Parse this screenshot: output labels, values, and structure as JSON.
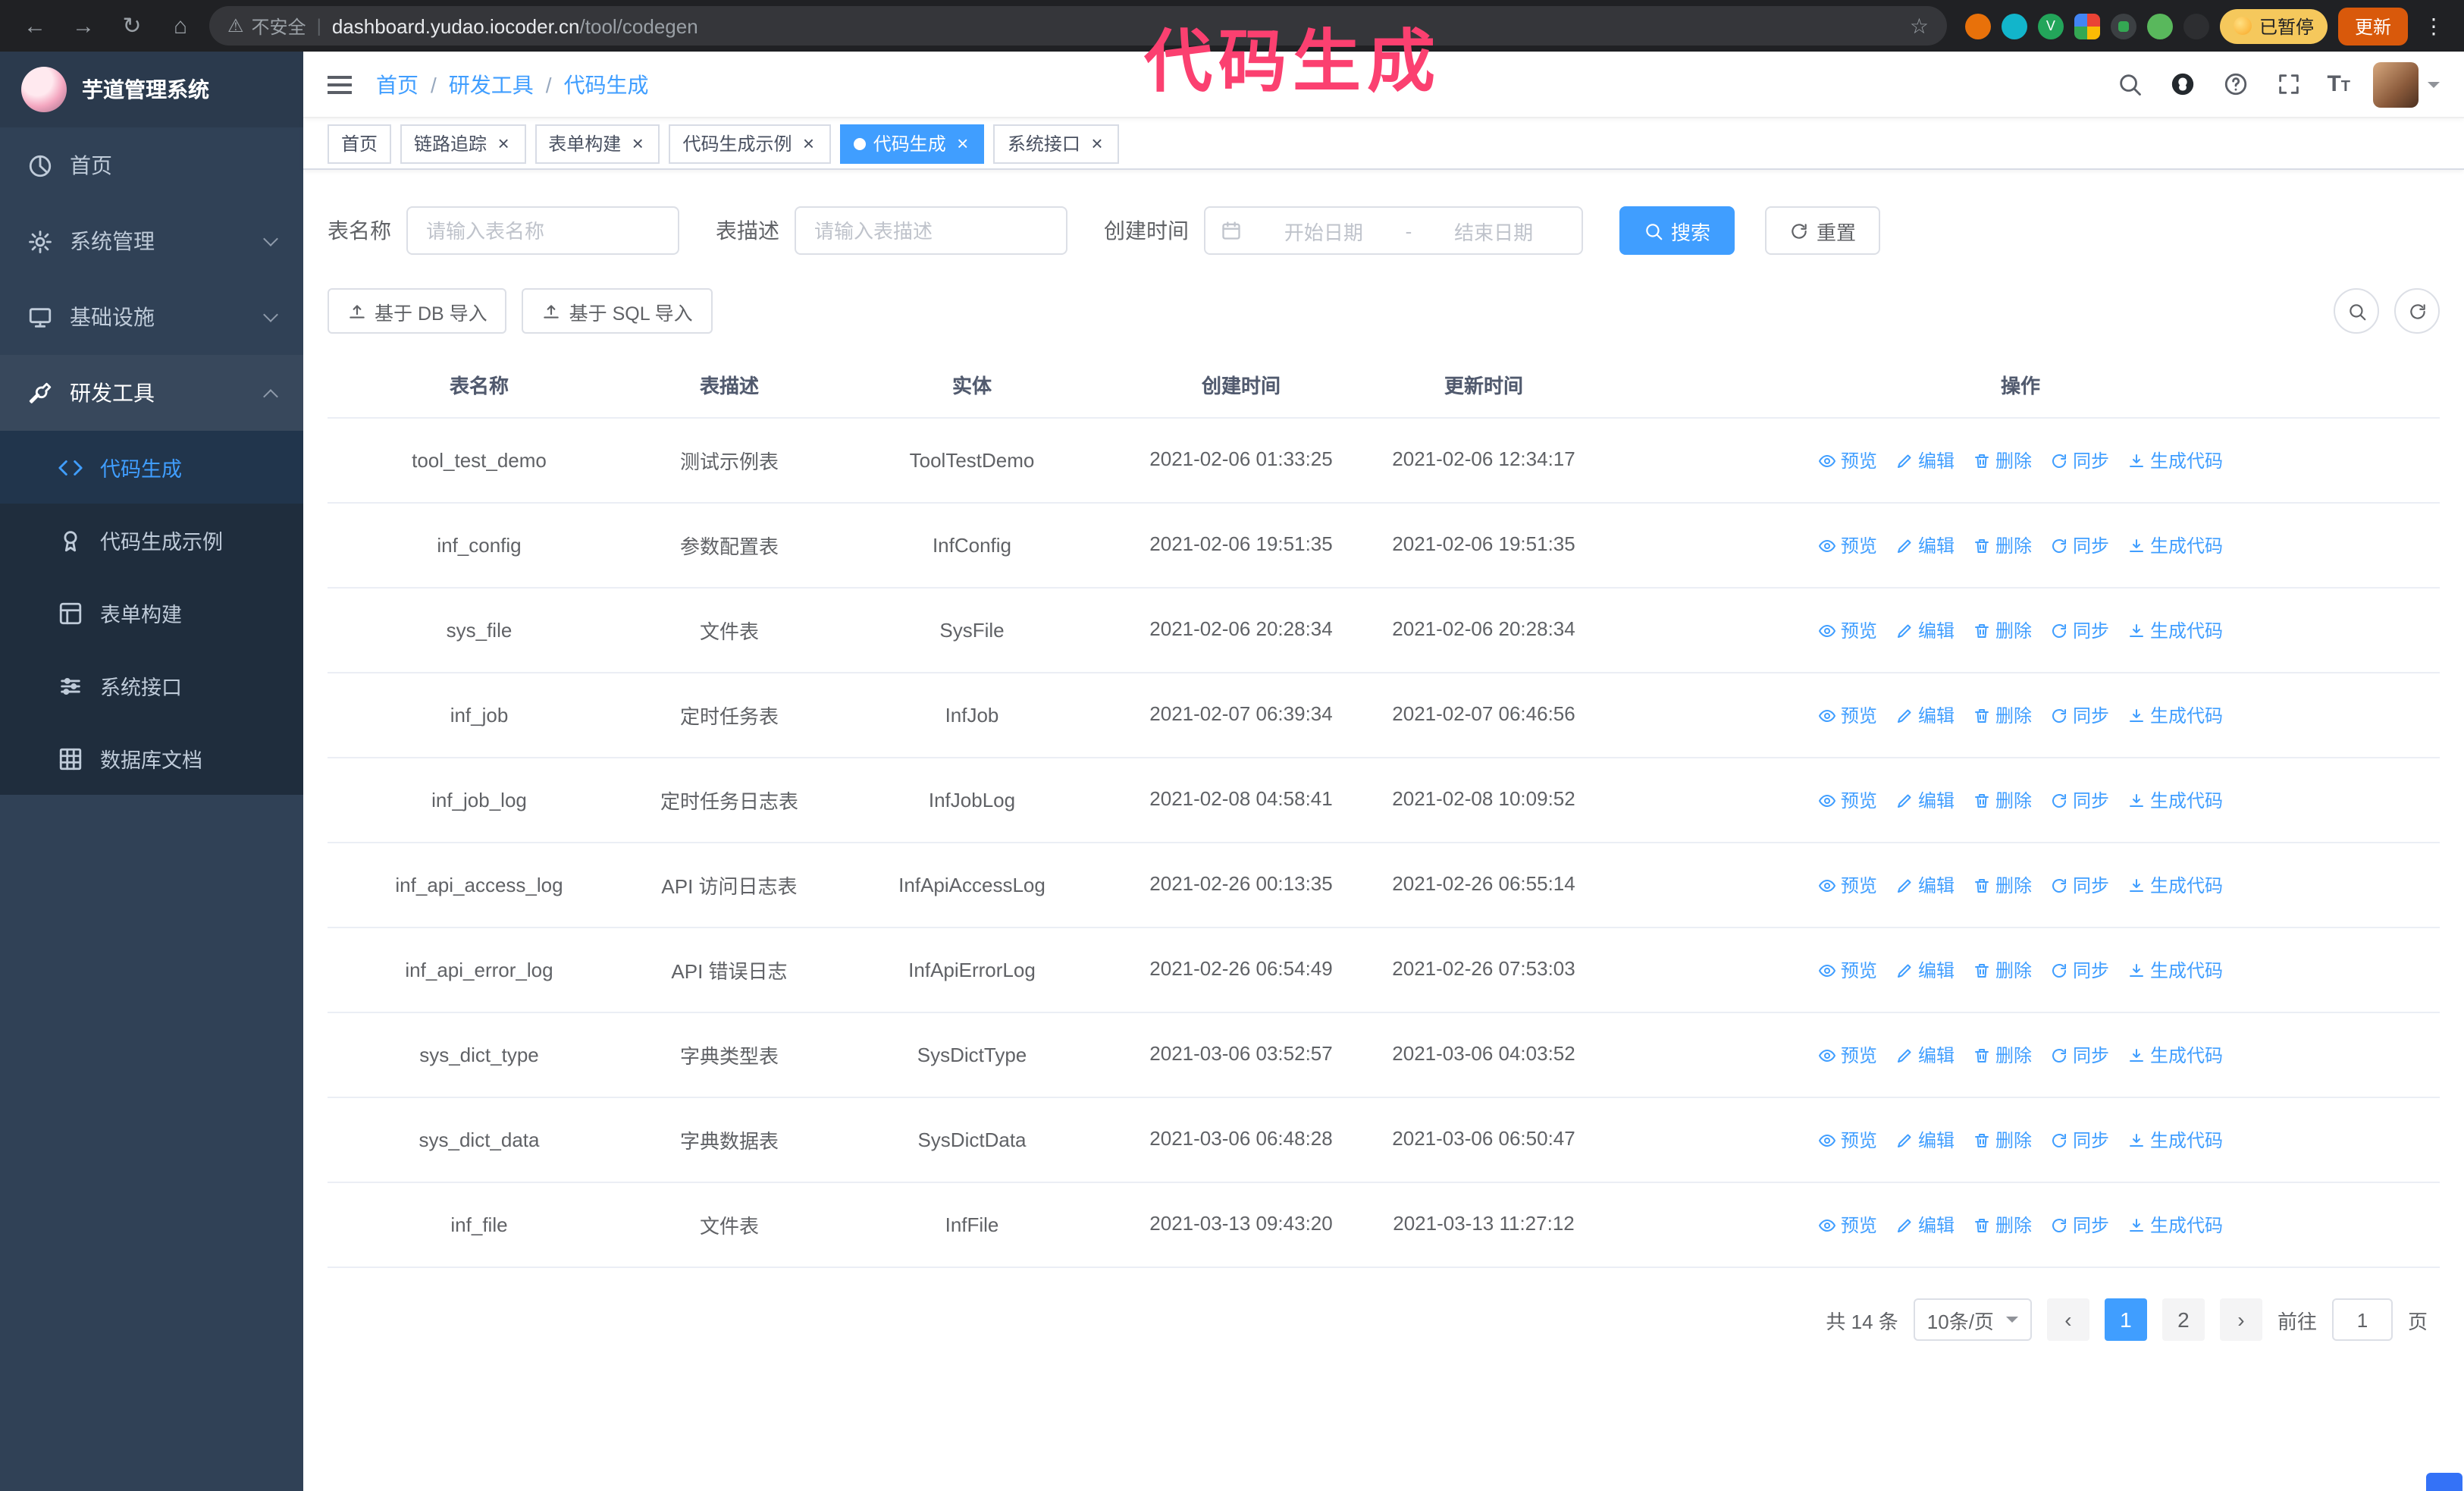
{
  "theme": {
    "accent": "#409eff",
    "sidebar_bg": "#304156",
    "submenu_bg": "#1f2d3d",
    "annotation_color": "#fb4070",
    "tag_active_bg": "#409eff"
  },
  "icons": {
    "back": "←",
    "forward": "→",
    "reload": "↻",
    "home": "⌂",
    "warning": "⚠",
    "divider": "|",
    "star": "☆",
    "kebab": "⋮",
    "prev": "‹",
    "next": "›",
    "v_badge": "V"
  },
  "browser": {
    "security_warning": "不安全",
    "url_host": "dashboard.yudao.iocoder.cn",
    "url_path": "/tool/codegen",
    "paused_badge": "已暂停",
    "update_button": "更新"
  },
  "annotation": {
    "text": "代码生成"
  },
  "sidebar": {
    "logo_title": "芋道管理系统",
    "items": [
      {
        "label": "首页"
      },
      {
        "label": "系统管理"
      },
      {
        "label": "基础设施"
      },
      {
        "label": "研发工具"
      }
    ],
    "submenu": [
      {
        "label": "代码生成"
      },
      {
        "label": "代码生成示例"
      },
      {
        "label": "表单构建"
      },
      {
        "label": "系统接口"
      },
      {
        "label": "数据库文档"
      }
    ]
  },
  "header": {
    "breadcrumb": [
      "首页",
      "研发工具",
      "代码生成"
    ],
    "separator": "/"
  },
  "tabs": [
    {
      "label": "首页",
      "closable": false,
      "active": false
    },
    {
      "label": "链路追踪",
      "closable": true,
      "active": false
    },
    {
      "label": "表单构建",
      "closable": true,
      "active": false
    },
    {
      "label": "代码生成示例",
      "closable": true,
      "active": false
    },
    {
      "label": "代码生成",
      "closable": true,
      "active": true
    },
    {
      "label": "系统接口",
      "closable": true,
      "active": false
    }
  ],
  "filters": {
    "table_name_label": "表名称",
    "table_name_placeholder": "请输入表名称",
    "table_desc_label": "表描述",
    "table_desc_placeholder": "请输入表描述",
    "create_time_label": "创建时间",
    "date_start_placeholder": "开始日期",
    "date_separator": "-",
    "date_end_placeholder": "结束日期",
    "search_button": "搜索",
    "reset_button": "重置"
  },
  "toolbar": {
    "import_db_button": "基于 DB 导入",
    "import_sql_button": "基于 SQL 导入"
  },
  "table": {
    "columns": [
      "表名称",
      "表描述",
      "实体",
      "创建时间",
      "更新时间",
      "操作"
    ],
    "op_labels": [
      "预览",
      "编辑",
      "删除",
      "同步",
      "生成代码"
    ],
    "rows": [
      {
        "name": "tool_test_demo",
        "desc": "测试示例表",
        "entity": "ToolTestDemo",
        "create_time": "2021-02-06 01:33:25",
        "update_time": "2021-02-06 12:34:17"
      },
      {
        "name": "inf_config",
        "desc": "参数配置表",
        "entity": "InfConfig",
        "create_time": "2021-02-06 19:51:35",
        "update_time": "2021-02-06 19:51:35"
      },
      {
        "name": "sys_file",
        "desc": "文件表",
        "entity": "SysFile",
        "create_time": "2021-02-06 20:28:34",
        "update_time": "2021-02-06 20:28:34"
      },
      {
        "name": "inf_job",
        "desc": "定时任务表",
        "entity": "InfJob",
        "create_time": "2021-02-07 06:39:34",
        "update_time": "2021-02-07 06:46:56"
      },
      {
        "name": "inf_job_log",
        "desc": "定时任务日志表",
        "entity": "InfJobLog",
        "create_time": "2021-02-08 04:58:41",
        "update_time": "2021-02-08 10:09:52"
      },
      {
        "name": "inf_api_access_log",
        "desc": "API 访问日志表",
        "entity": "InfApiAccessLog",
        "create_time": "2021-02-26 00:13:35",
        "update_time": "2021-02-26 06:55:14"
      },
      {
        "name": "inf_api_error_log",
        "desc": "API 错误日志",
        "entity": "InfApiErrorLog",
        "create_time": "2021-02-26 06:54:49",
        "update_time": "2021-02-26 07:53:03"
      },
      {
        "name": "sys_dict_type",
        "desc": "字典类型表",
        "entity": "SysDictType",
        "create_time": "2021-03-06 03:52:57",
        "update_time": "2021-03-06 04:03:52"
      },
      {
        "name": "sys_dict_data",
        "desc": "字典数据表",
        "entity": "SysDictData",
        "create_time": "2021-03-06 06:48:28",
        "update_time": "2021-03-06 06:50:47"
      },
      {
        "name": "inf_file",
        "desc": "文件表",
        "entity": "InfFile",
        "create_time": "2021-03-13 09:43:20",
        "update_time": "2021-03-13 11:27:12"
      }
    ]
  },
  "pagination": {
    "total_text": "共 14 条",
    "page_size": "10条/页",
    "pages": [
      "1",
      "2"
    ],
    "active_page": "1",
    "goto_label": "前往",
    "goto_value": "1",
    "goto_suffix": "页"
  }
}
